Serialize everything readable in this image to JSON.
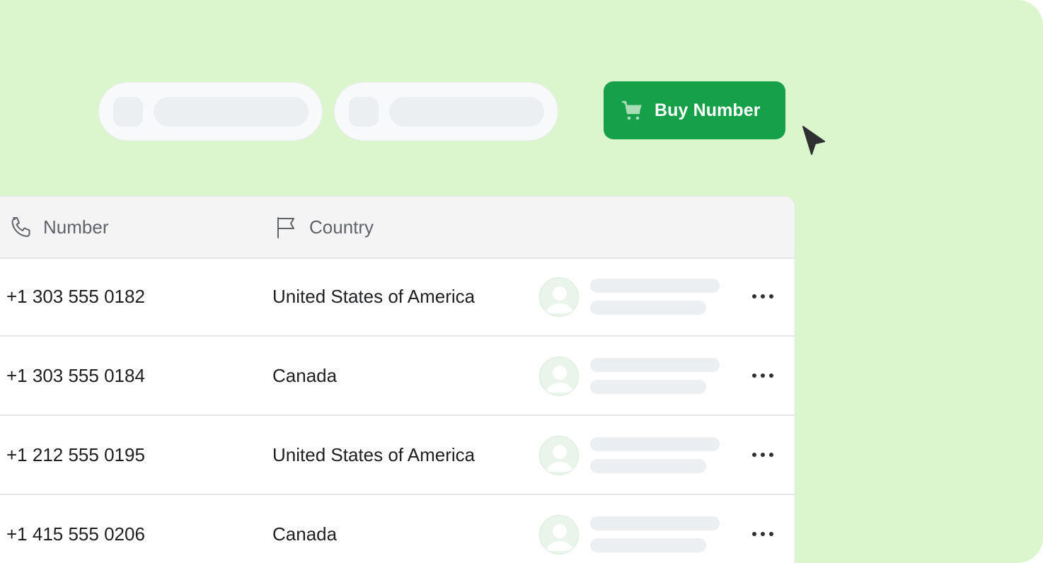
{
  "buy_button": {
    "label": "Buy Number"
  },
  "table": {
    "columns": [
      {
        "label": "Number",
        "icon": "phone-icon"
      },
      {
        "label": "Country",
        "icon": "flag-icon"
      }
    ],
    "rows": [
      {
        "number": "+1 303 555 0182",
        "country": "United States of America"
      },
      {
        "number": "+1 303 555 0184",
        "country": "Canada"
      },
      {
        "number": "+1 212 555 0195",
        "country": "United States of America"
      },
      {
        "number": "+1 415 555 0206",
        "country": "Canada"
      }
    ]
  },
  "colors": {
    "background": "#dbf6cc",
    "accent": "#16a049",
    "text": "#1e1f21",
    "header_text": "#5f6368"
  }
}
